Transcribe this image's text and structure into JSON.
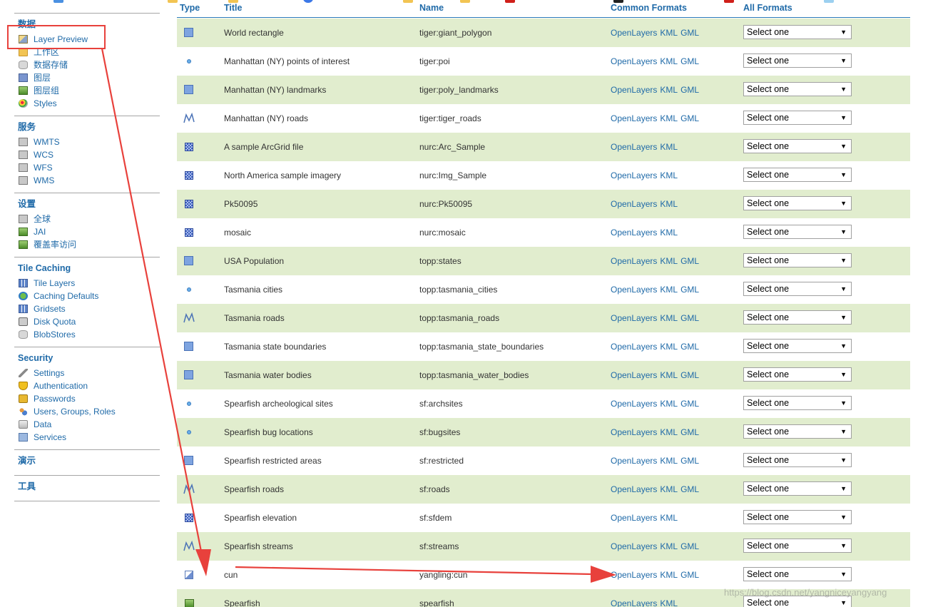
{
  "sidebar": {
    "sections": [
      {
        "title": "数据",
        "items": [
          {
            "label": "Layer Preview",
            "icon": "layer-preview-icon"
          },
          {
            "label": "工作区",
            "icon": "folder-icon"
          },
          {
            "label": "数据存储",
            "icon": "database-icon"
          },
          {
            "label": "图层",
            "icon": "layers-icon"
          },
          {
            "label": "图层组",
            "icon": "layer-group-icon"
          },
          {
            "label": "Styles",
            "icon": "palette-icon"
          }
        ]
      },
      {
        "title": "服务",
        "items": [
          {
            "label": "WMTS",
            "icon": "service-icon"
          },
          {
            "label": "WCS",
            "icon": "service-icon"
          },
          {
            "label": "WFS",
            "icon": "service-icon"
          },
          {
            "label": "WMS",
            "icon": "service-icon"
          }
        ]
      },
      {
        "title": "设置",
        "items": [
          {
            "label": "全球",
            "icon": "server-icon"
          },
          {
            "label": "JAI",
            "icon": "jai-icon"
          },
          {
            "label": "覆盖率访问",
            "icon": "coverage-icon"
          }
        ]
      },
      {
        "title": "Tile Caching",
        "items": [
          {
            "label": "Tile Layers",
            "icon": "tile-layers-icon"
          },
          {
            "label": "Caching Defaults",
            "icon": "globe-icon"
          },
          {
            "label": "Gridsets",
            "icon": "grid-icon"
          },
          {
            "label": "Disk Quota",
            "icon": "disk-icon"
          },
          {
            "label": "BlobStores",
            "icon": "blobstore-icon"
          }
        ]
      },
      {
        "title": "Security",
        "items": [
          {
            "label": "Settings",
            "icon": "wrench-icon"
          },
          {
            "label": "Authentication",
            "icon": "shield-icon"
          },
          {
            "label": "Passwords",
            "icon": "lock-icon"
          },
          {
            "label": "Users, Groups, Roles",
            "icon": "users-icon"
          },
          {
            "label": "Data",
            "icon": "data-icon"
          },
          {
            "label": "Services",
            "icon": "services-icon"
          }
        ]
      },
      {
        "title": "演示",
        "items": []
      },
      {
        "title": "工具",
        "items": []
      }
    ]
  },
  "table": {
    "headers": {
      "type": "Type",
      "title": "Title",
      "name": "Name",
      "common": "Common Formats",
      "all": "All Formats"
    },
    "select_placeholder": "Select one",
    "link_openlayers": "OpenLayers",
    "link_kml": "KML",
    "link_gml": "GML",
    "rows": [
      {
        "type": "polygon",
        "title": "World rectangle",
        "name": "tiger:giant_polygon",
        "gml": true
      },
      {
        "type": "point",
        "title": "Manhattan (NY) points of interest",
        "name": "tiger:poi",
        "gml": true
      },
      {
        "type": "polygon",
        "title": "Manhattan (NY) landmarks",
        "name": "tiger:poly_landmarks",
        "gml": true
      },
      {
        "type": "line",
        "title": "Manhattan (NY) roads",
        "name": "tiger:tiger_roads",
        "gml": true
      },
      {
        "type": "raster",
        "title": "A sample ArcGrid file",
        "name": "nurc:Arc_Sample",
        "gml": false
      },
      {
        "type": "raster",
        "title": "North America sample imagery",
        "name": "nurc:Img_Sample",
        "gml": false
      },
      {
        "type": "raster",
        "title": "Pk50095",
        "name": "nurc:Pk50095",
        "gml": false
      },
      {
        "type": "raster",
        "title": "mosaic",
        "name": "nurc:mosaic",
        "gml": false
      },
      {
        "type": "polygon",
        "title": "USA Population",
        "name": "topp:states",
        "gml": true
      },
      {
        "type": "point",
        "title": "Tasmania cities",
        "name": "topp:tasmania_cities",
        "gml": true
      },
      {
        "type": "line",
        "title": "Tasmania roads",
        "name": "topp:tasmania_roads",
        "gml": true
      },
      {
        "type": "polygon",
        "title": "Tasmania state boundaries",
        "name": "topp:tasmania_state_boundaries",
        "gml": true
      },
      {
        "type": "polygon",
        "title": "Tasmania water bodies",
        "name": "topp:tasmania_water_bodies",
        "gml": true
      },
      {
        "type": "point",
        "title": "Spearfish archeological sites",
        "name": "sf:archsites",
        "gml": true
      },
      {
        "type": "point",
        "title": "Spearfish bug locations",
        "name": "sf:bugsites",
        "gml": true
      },
      {
        "type": "polygon",
        "title": "Spearfish restricted areas",
        "name": "sf:restricted",
        "gml": true
      },
      {
        "type": "line",
        "title": "Spearfish roads",
        "name": "sf:roads",
        "gml": true
      },
      {
        "type": "raster",
        "title": "Spearfish elevation",
        "name": "sf:sfdem",
        "gml": false
      },
      {
        "type": "line",
        "title": "Spearfish streams",
        "name": "sf:streams",
        "gml": true
      },
      {
        "type": "generic",
        "title": "cun",
        "name": "yangling:cun",
        "gml": true
      },
      {
        "type": "group",
        "title": "Spearfish",
        "name": "spearfish",
        "gml": false
      }
    ]
  },
  "watermark": "https://blog.csdn.net/yangniceyangyang",
  "annotation_color": "#e8413c"
}
